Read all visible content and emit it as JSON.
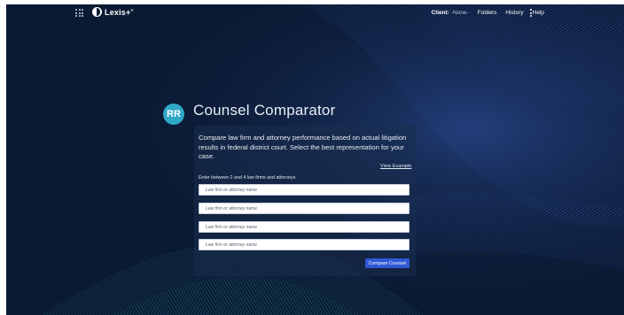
{
  "header": {
    "brand": "Lexis+",
    "brand_mark": "®",
    "client_label": "Client:",
    "client_value": "-None-",
    "nav_items": [
      "Folders",
      "History",
      "Help"
    ]
  },
  "page": {
    "avatar_initials": "RR",
    "title": "Counsel Comparator",
    "description": "Compare law firm and attorney performance based on actual litigation results in federal district court. Select the best representation for your case.",
    "view_example": "View Example",
    "instruction": "Enter between 2 and 4 law firms and attorneys.",
    "inputs": [
      {
        "placeholder": "Law firm or attorney name",
        "value": ""
      },
      {
        "placeholder": "Law firm or attorney name",
        "value": ""
      },
      {
        "placeholder": "Law firm or attorney name",
        "value": ""
      },
      {
        "placeholder": "Law firm or attorney name",
        "value": ""
      }
    ],
    "submit_label": "Compare Counsel"
  },
  "colors": {
    "background": "#0b1a33",
    "accent_button": "#2f57d6",
    "avatar": "#2fa8c8",
    "wave_blue": "#3a63d8",
    "wave_teal": "#27b3b8"
  },
  "icons": [
    "apps-grid-icon",
    "lexis-logo-icon",
    "more-vertical-icon"
  ]
}
